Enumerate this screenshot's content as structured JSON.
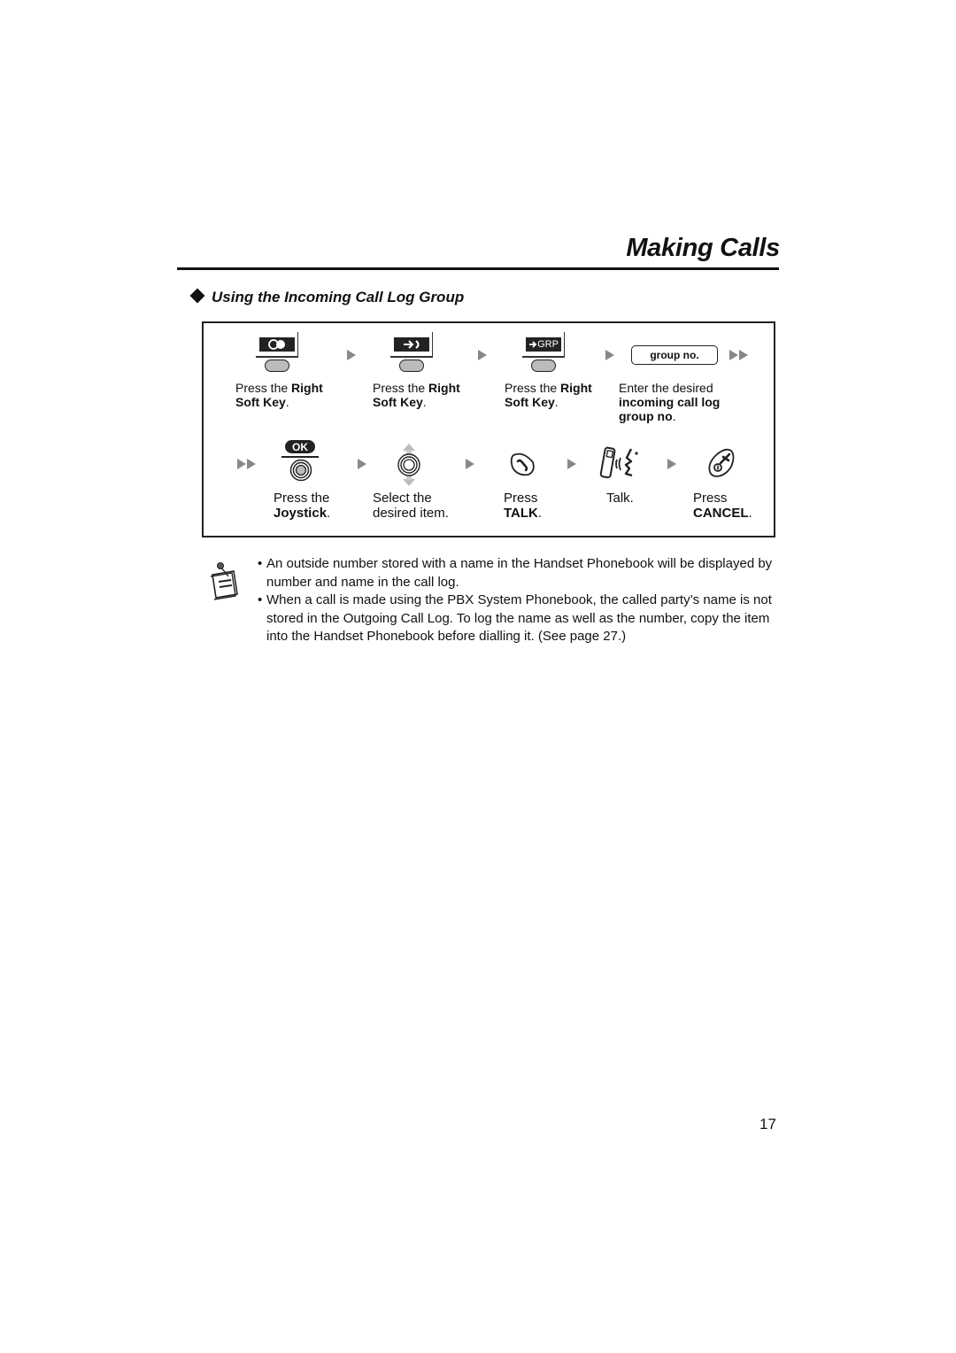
{
  "header": {
    "section_title": "Making Calls",
    "subheading": "Using the Incoming Call Log Group"
  },
  "procedure": {
    "row1": [
      {
        "icon": "softkey-circles-icon",
        "key_display": "",
        "pre": "Press the ",
        "bold1": "Right",
        "line2_bold": "Soft Key",
        "line2_end": "."
      },
      {
        "icon": "softkey-arrow-icon",
        "key_display": "",
        "pre": "Press the ",
        "bold1": "Right",
        "line2_bold": "Soft Key",
        "line2_end": "."
      },
      {
        "icon": "softkey-grp-icon",
        "key_display": "GRP",
        "pre": "Press the ",
        "bold1": "Right",
        "line2_bold": "Soft Key",
        "line2_end": "."
      },
      {
        "icon": "input-box-icon",
        "input_label": "group no.",
        "line1": "Enter the desired",
        "line2_bold": "incoming call log",
        "line3_bold": "group no",
        "line3_end": "."
      }
    ],
    "row2": [
      {
        "icon": "joystick-ok-icon",
        "key_display": "OK",
        "line1": "Press the",
        "line2_bold": "Joystick",
        "line2_end": "."
      },
      {
        "icon": "joystick-updown-icon",
        "line1": "Select the",
        "line2": "desired item."
      },
      {
        "icon": "talk-button-icon",
        "line1": "Press",
        "line2_bold": "TALK",
        "line2_end": "."
      },
      {
        "icon": "handset-talk-icon",
        "line1": "Talk."
      },
      {
        "icon": "cancel-button-icon",
        "line1": "Press",
        "line2_bold": "CANCEL",
        "line2_end": "."
      }
    ]
  },
  "notes": {
    "icon": "notepad-icon",
    "items": [
      {
        "text": "An outside number stored with a name in the Handset Phonebook will be displayed by number and name in the call log."
      },
      {
        "text": "When a call is made using the PBX System Phonebook, the called party’s name is not stored in the Outgoing Call Log. To log the name as well as the number, copy the item into the Handset Phonebook before dialling it. (See page 27.)"
      }
    ],
    "bullet": "•"
  },
  "footer": {
    "page_number": "17"
  }
}
